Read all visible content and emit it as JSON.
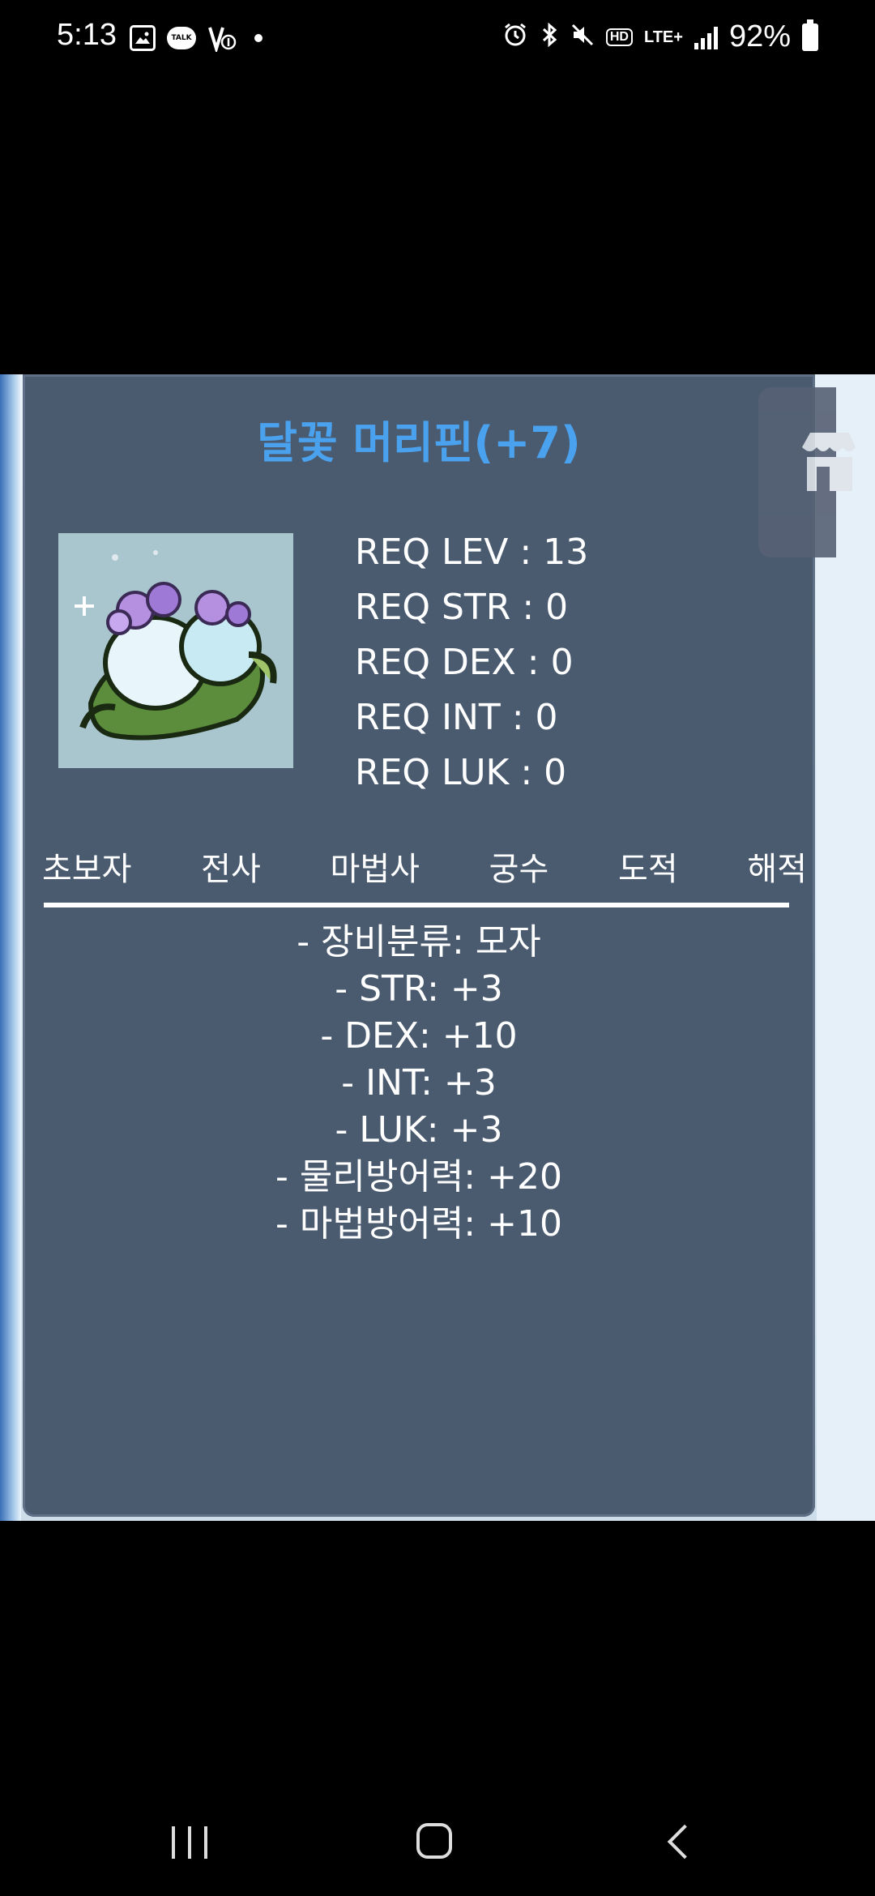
{
  "status_bar": {
    "time": "5:13",
    "battery": "92%",
    "network": "LTE+",
    "hd_label": "HD",
    "talk_label": "TALK",
    "left_icons": [
      "gallery-icon",
      "kakaotalk-icon",
      "vpn-icon",
      "more-dot-icon"
    ],
    "right_icons": [
      "alarm-icon",
      "bluetooth-icon",
      "mute-icon",
      "hd-icon",
      "lte-icon",
      "signal-icon",
      "battery-icon"
    ]
  },
  "item": {
    "title": "달꽃 머리핀(+7)",
    "requirements": [
      "REQ LEV : 13",
      "REQ STR : 0",
      "REQ DEX : 0",
      "REQ INT : 0",
      "REQ LUK : 0"
    ],
    "jobs": [
      "초보자",
      "전사",
      "마법사",
      "궁수",
      "도적",
      "해적"
    ],
    "stats": [
      "- 장비분류: 모자",
      "- STR: +3",
      "- DEX: +10",
      "- INT: +3",
      "- LUK: +3",
      "- 물리방어력: +20",
      "- 마법방어력: +10"
    ]
  },
  "colors": {
    "title": "#4aa1ee",
    "panel": "#4a5b70",
    "background": "#000000"
  },
  "nav": [
    "recent-apps",
    "home",
    "back"
  ]
}
